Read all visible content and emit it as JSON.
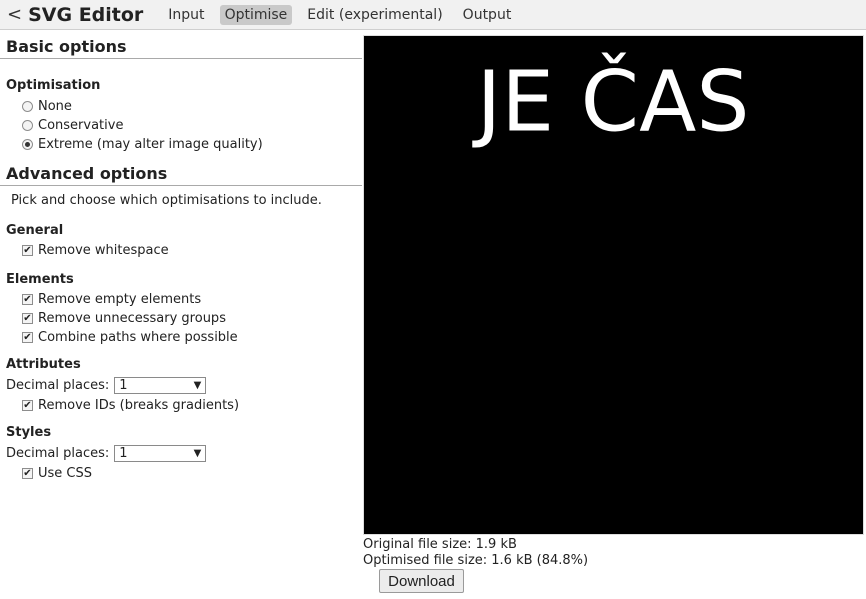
{
  "header": {
    "back_symbol": "<",
    "title": "SVG Editor",
    "nav": [
      "Input",
      "Optimise",
      "Edit (experimental)",
      "Output"
    ]
  },
  "basic": {
    "heading": "Basic options",
    "optimisation_label": "Optimisation",
    "options": [
      "None",
      "Conservative",
      "Extreme (may alter image quality)"
    ],
    "selected": "Extreme (may alter image quality)"
  },
  "advanced": {
    "heading": "Advanced options",
    "description": "Pick and choose which optimisations to include.",
    "general": {
      "label": "General",
      "remove_whitespace": "Remove whitespace"
    },
    "elements": {
      "label": "Elements",
      "remove_empty": "Remove empty elements",
      "remove_groups": "Remove unnecessary groups",
      "combine_paths": "Combine paths where possible"
    },
    "attributes": {
      "label": "Attributes",
      "decimal_label": "Decimal places:",
      "decimal_value": "1",
      "remove_ids": "Remove IDs (breaks gradients)"
    },
    "styles": {
      "label": "Styles",
      "decimal_label": "Decimal places:",
      "decimal_value": "1",
      "use_css": "Use CSS"
    }
  },
  "preview": {
    "text": "JE ČAS",
    "background": "#000000",
    "foreground": "#ffffff"
  },
  "info": {
    "original": "Original file size: 1.9 kB",
    "optimised": "Optimised file size: 1.6 kB (84.8%)"
  },
  "download_label": "Download"
}
